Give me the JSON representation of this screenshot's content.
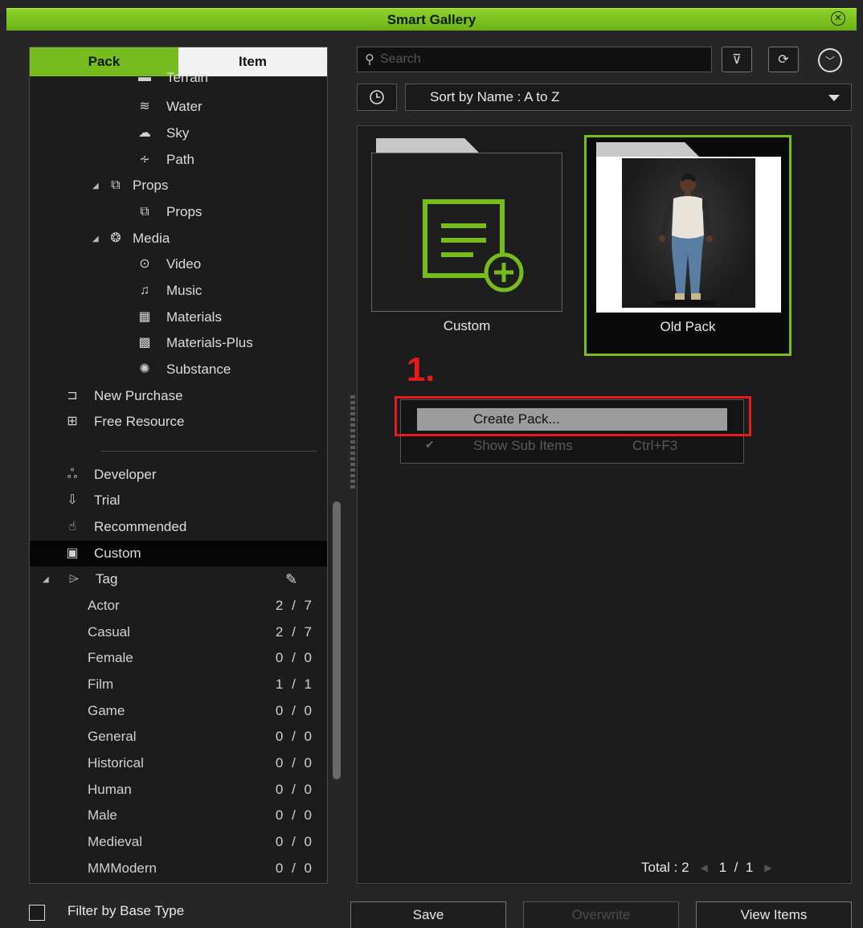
{
  "window": {
    "title": "Smart Gallery"
  },
  "tabs": {
    "pack": "Pack",
    "item": "Item"
  },
  "tree": {
    "items": [
      {
        "label": "Terrain",
        "icon": "terrain-icon"
      },
      {
        "label": "Water",
        "icon": "water-icon"
      },
      {
        "label": "Sky",
        "icon": "cloud-icon"
      },
      {
        "label": "Path",
        "icon": "path-icon"
      },
      {
        "label": "Props",
        "icon": "props-icon"
      },
      {
        "label": "Props",
        "icon": "props-icon"
      },
      {
        "label": "Media",
        "icon": "media-icon"
      },
      {
        "label": "Video",
        "icon": "play-icon"
      },
      {
        "label": "Music",
        "icon": "music-icon"
      },
      {
        "label": "Materials",
        "icon": "checker-icon"
      },
      {
        "label": "Materials-Plus",
        "icon": "checker-plus-icon"
      },
      {
        "label": "Substance",
        "icon": "substance-icon"
      },
      {
        "label": "New Purchase",
        "icon": "cart-icon"
      },
      {
        "label": "Free Resource",
        "icon": "gift-icon"
      },
      {
        "label": "Developer",
        "icon": "developer-icon"
      },
      {
        "label": "Trial",
        "icon": "trial-icon"
      },
      {
        "label": "Recommended",
        "icon": "thumbs-up-icon"
      },
      {
        "label": "Custom",
        "icon": "custom-icon"
      },
      {
        "label": "Tag",
        "icon": "tag-icon"
      }
    ],
    "tags": [
      {
        "name": "Actor",
        "count": "2 / 7"
      },
      {
        "name": "Casual",
        "count": "2 / 7"
      },
      {
        "name": "Female",
        "count": "0 / 0"
      },
      {
        "name": "Film",
        "count": "1 / 1"
      },
      {
        "name": "Game",
        "count": "0 / 0"
      },
      {
        "name": "General",
        "count": "0 / 0"
      },
      {
        "name": "Historical",
        "count": "0 / 0"
      },
      {
        "name": "Human",
        "count": "0 / 0"
      },
      {
        "name": "Male",
        "count": "0 / 0"
      },
      {
        "name": "Medieval",
        "count": "0 / 0"
      },
      {
        "name": "MMModern",
        "count": "0 / 0"
      }
    ]
  },
  "search": {
    "placeholder": "Search"
  },
  "sort": {
    "label": "Sort by Name : A to Z"
  },
  "packs": [
    {
      "label": "Custom"
    },
    {
      "label": "Old Pack"
    }
  ],
  "annotation": {
    "step": "1."
  },
  "context_menu": {
    "create_pack": "Create Pack...",
    "show_sub_items": "Show Sub Items",
    "show_sub_items_shortcut": "Ctrl+F3"
  },
  "pager": {
    "total": "Total : 2",
    "page": "1  /  1"
  },
  "footer": {
    "filter_label": "Filter by Base Type",
    "save": "Save",
    "overwrite": "Overwrite",
    "view_items": "View Items"
  },
  "colors": {
    "accent": "#77bc1f",
    "annotation": "#e61c1c"
  }
}
